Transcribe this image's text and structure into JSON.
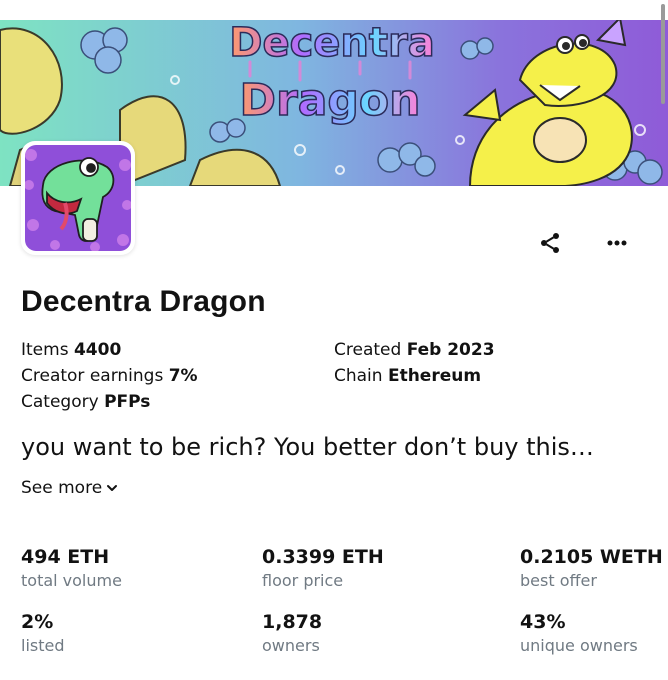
{
  "banner": {
    "title_line1": "Decentra",
    "title_line2": "Dragon",
    "colors": {
      "sky_left": "#7ee3c2",
      "sky_right": "#8f5bd8",
      "dragon_yellow": "#f5f04a"
    }
  },
  "avatar": {
    "icon": "dragon-avatar-icon",
    "colors": {
      "background": "#8f4fd9",
      "dragon": "#73e09a"
    }
  },
  "actions": {
    "share_icon": "share-icon",
    "more_icon": "more-horizontal-icon"
  },
  "collection": {
    "name": "Decentra Dragon",
    "details": {
      "items_label": "Items",
      "items_value": "4400",
      "creator_label": "Creator earnings",
      "creator_value": "7%",
      "category_label": "Category",
      "category_value": "PFPs",
      "created_label": "Created",
      "created_value": "Feb 2023",
      "chain_label": "Chain",
      "chain_value": "Ethereum"
    },
    "description": "you want to be rich? You better don’t buy this…",
    "see_more": "See more"
  },
  "stats": [
    {
      "value": "494 ETH",
      "label": "total volume"
    },
    {
      "value": "0.3399 ETH",
      "label": "floor price"
    },
    {
      "value": "0.2105 WETH",
      "label": "best offer"
    },
    {
      "value": "2%",
      "label": "listed"
    },
    {
      "value": "1,878",
      "label": "owners"
    },
    {
      "value": "43%",
      "label": "unique owners"
    }
  ]
}
